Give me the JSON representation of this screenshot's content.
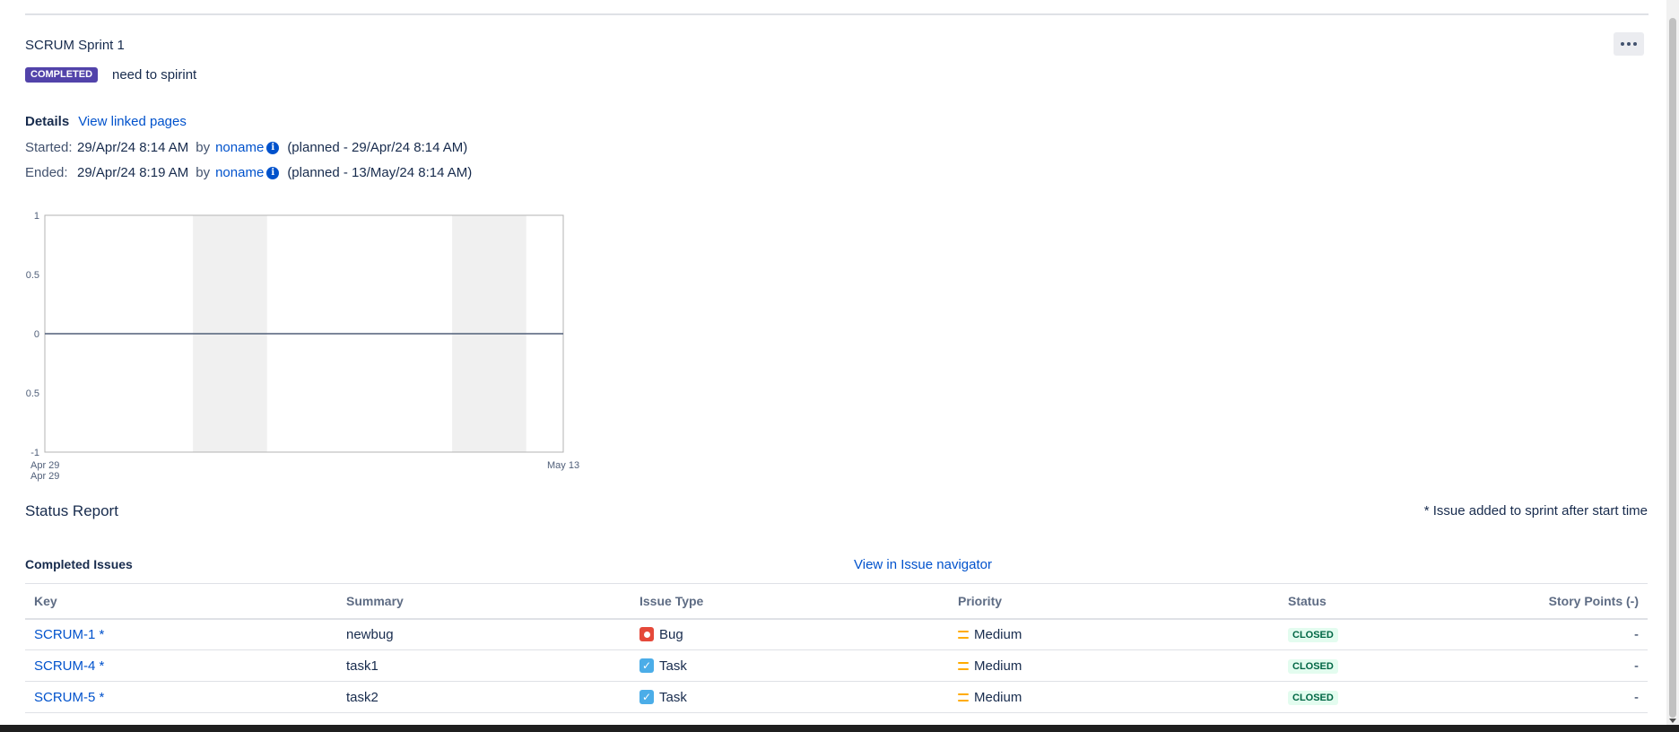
{
  "sprint": {
    "name": "SCRUM Sprint 1",
    "status_badge": "COMPLETED",
    "goal": "need to spirint"
  },
  "details": {
    "label": "Details",
    "linked_pages_link": "View linked pages",
    "started": {
      "label": "Started:",
      "date": "29/Apr/24 8:14 AM",
      "by": "by",
      "user": "noname",
      "planned": "(planned - 29/Apr/24 8:14 AM)"
    },
    "ended": {
      "label": "Ended:",
      "date": "29/Apr/24 8:19 AM",
      "by": "by",
      "user": "noname",
      "planned": "(planned - 13/May/24 8:14 AM)"
    }
  },
  "chart_data": {
    "type": "line",
    "title": "",
    "xlabel": "",
    "ylabel": "",
    "ylim": [
      -1,
      1
    ],
    "y_tick_labels": [
      "1",
      "0.5",
      "0",
      "0.5",
      "-1"
    ],
    "x_tick_labels": [
      "Apr 29",
      "May 13"
    ],
    "x_sublabel": "Apr 29",
    "x": [
      "Apr 29",
      "May 13"
    ],
    "series": [
      {
        "values": [
          0,
          0
        ]
      }
    ],
    "non_working_bands": [
      {
        "from_day": 4,
        "to_day": 6
      },
      {
        "from_day": 11,
        "to_day": 13
      }
    ],
    "total_days": 14,
    "grid": false
  },
  "status_report": {
    "title": "Status Report",
    "note": "* Issue added to sprint after start time"
  },
  "completed_issues": {
    "title": "Completed Issues",
    "navigator_link": "View in Issue navigator",
    "columns": [
      "Key",
      "Summary",
      "Issue Type",
      "Priority",
      "Status",
      "Story Points (-)"
    ],
    "rows": [
      {
        "key": "SCRUM-1 *",
        "summary": "newbug",
        "type": "Bug",
        "type_icon": "bug-icon",
        "priority": "Medium",
        "status": "CLOSED",
        "points": "-"
      },
      {
        "key": "SCRUM-4 *",
        "summary": "task1",
        "type": "Task",
        "type_icon": "task-icon",
        "priority": "Medium",
        "status": "CLOSED",
        "points": "-"
      },
      {
        "key": "SCRUM-5 *",
        "summary": "task2",
        "type": "Task",
        "type_icon": "task-icon",
        "priority": "Medium",
        "status": "CLOSED",
        "points": "-"
      }
    ]
  },
  "colors": {
    "completed_badge": "#5243aa",
    "link": "#0052cc",
    "bug": "#e5493a",
    "task": "#4bade8",
    "priority_medium": "#ffab00",
    "closed_text": "#006644",
    "closed_bg": "#e3fcef"
  }
}
